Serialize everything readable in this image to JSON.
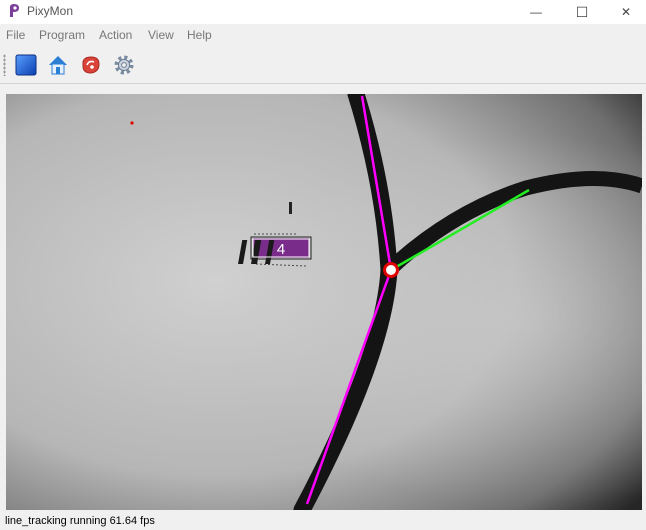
{
  "window": {
    "title": "PixyMon",
    "icon": "pixy-logo-icon"
  },
  "window_controls": {
    "minimize": "—",
    "maximize": "☐",
    "close": "✕"
  },
  "menu": [
    {
      "label": "File"
    },
    {
      "label": "Program"
    },
    {
      "label": "Action"
    },
    {
      "label": "View"
    },
    {
      "label": "Help"
    }
  ],
  "toolbar": {
    "buttons": [
      {
        "icon": "raw-video-icon"
      },
      {
        "icon": "home-icon"
      },
      {
        "icon": "steak-icon"
      },
      {
        "icon": "gear-icon"
      }
    ]
  },
  "video": {
    "barcode_label": "4",
    "colors": {
      "primary_vector": "#ff00ff",
      "secondary_vector": "#22ee22",
      "intersection": "#e00000",
      "barcode_box": "#7a2c8a"
    }
  },
  "status": {
    "text": "line_tracking running 61.64 fps"
  }
}
